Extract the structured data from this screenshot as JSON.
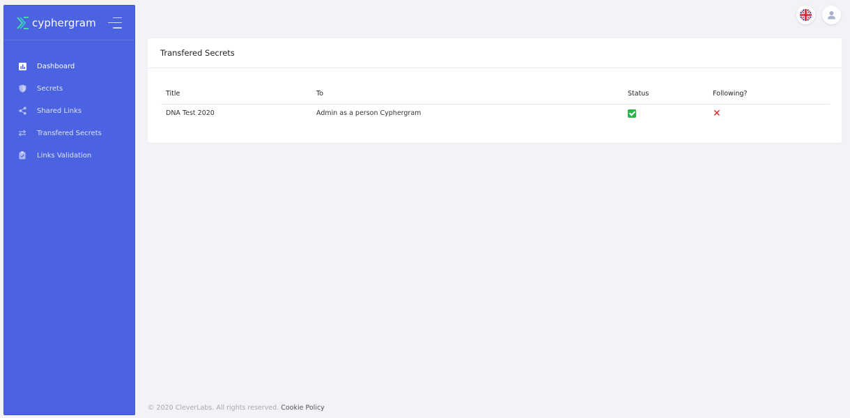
{
  "app": {
    "brand": "cyphergram"
  },
  "sidebar": {
    "items": [
      {
        "label": "Dashboard",
        "icon": "bar-chart-icon"
      },
      {
        "label": "Secrets",
        "icon": "shield-icon"
      },
      {
        "label": "Shared Links",
        "icon": "share-icon"
      },
      {
        "label": "Transfered Secrets",
        "icon": "transfer-arrows-icon"
      },
      {
        "label": "Links Validation",
        "icon": "clipboard-check-icon"
      }
    ]
  },
  "topbar": {
    "language_icon": "uk-flag-icon",
    "user_icon": "user-icon"
  },
  "card": {
    "title": "Transfered Secrets",
    "columns": [
      "Title",
      "To",
      "Status",
      "Following?"
    ],
    "rows": [
      {
        "title": "DNA Test 2020",
        "to": "Admin as a person Cyphergram",
        "status": "check-icon",
        "following": "x-icon"
      }
    ]
  },
  "footer": {
    "copyright": "© 2020 CleverLabs. All rights reserved.",
    "link": "Cookie Policy"
  },
  "colors": {
    "sidebar": "#4b63e0",
    "background": "#f2f2f7",
    "status_ok": "#2db34a",
    "status_no": "#e01b1b"
  }
}
